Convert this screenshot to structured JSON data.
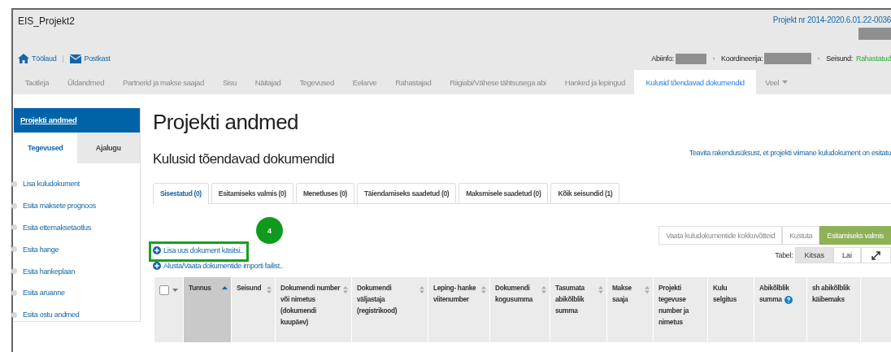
{
  "window": {
    "title": "EIS_Projekt2",
    "project_number": "Projekt nr 2014-2020.6.01.22-0036"
  },
  "quick_links": [
    {
      "kind": "home",
      "label": "Töölaud"
    },
    {
      "kind": "mail",
      "label": "Postkast"
    }
  ],
  "info": {
    "help_label": "Abiinfo:",
    "coordinator_label": "Koordineerija:",
    "status_label": "Seisund:",
    "status_value": "Rahastatud"
  },
  "tabs": [
    {
      "label": "Taotleja",
      "selected": false
    },
    {
      "label": "Üldandmed",
      "selected": false
    },
    {
      "label": "Partnerid ja makse saajad",
      "selected": false
    },
    {
      "label": "Sisu",
      "selected": false
    },
    {
      "label": "Näitajad",
      "selected": false
    },
    {
      "label": "Tegevused",
      "selected": false
    },
    {
      "label": "Eelarve",
      "selected": false
    },
    {
      "label": "Rahastajad",
      "selected": false
    },
    {
      "label": "Riigiabi/Vähese tähtsusega abi",
      "selected": false
    },
    {
      "label": "Hanked ja lepingud",
      "selected": false
    },
    {
      "label": "Kulusid tõendavad dokumendid",
      "selected": true
    },
    {
      "label": "Veel",
      "selected": false,
      "dropdown": true
    }
  ],
  "sidebar": {
    "header": "Projekti andmed",
    "tabs": [
      {
        "label": "Tegevused",
        "selected": true
      },
      {
        "label": "Ajalugu",
        "selected": false
      }
    ],
    "items": [
      "Lisa kuludokument",
      "Esita maksete prognoos",
      "Esita ettemaksetaotlus",
      "Esita hange",
      "Esita hankeplaan",
      "Esita aruanne",
      "Esita ostu andmed"
    ]
  },
  "page_title": "Projekti andmed",
  "section_title": "Kulusid tõendavad dokumendid",
  "notify_link": "Teavita rakendusüksust, et projekti viimane kuludokument on esitatu",
  "status_tabs": [
    {
      "label": "Sisestatud (0)",
      "selected": true
    },
    {
      "label": "Esitamiseks valmis (0)",
      "selected": false
    },
    {
      "label": "Menetluses (0)",
      "selected": false
    },
    {
      "label": "Täiendamiseks saadetud (0)",
      "selected": false
    },
    {
      "label": "Maksmisele saadetud (0)",
      "selected": false
    },
    {
      "label": "Kõik seisundid (1)",
      "selected": false
    }
  ],
  "step_badge": "4",
  "add_links": [
    {
      "label": "Lisa uus dokument käsitsi..",
      "highlighted": true
    },
    {
      "label": "Alusta/Vaata dokumentide importi failist..",
      "highlighted": false
    }
  ],
  "action_buttons": [
    {
      "label": "Vaata kuludokumentide kokkuvõtteid",
      "kind": "default"
    },
    {
      "label": "Kustuta",
      "kind": "default"
    },
    {
      "label": "Esitamiseks valmis",
      "kind": "primary"
    }
  ],
  "table_view": {
    "label": "Tabel:",
    "options": [
      {
        "label": "Kitsas",
        "selected": true
      },
      {
        "label": "Lai",
        "selected": false
      }
    ]
  },
  "table": {
    "select_all_checked": false,
    "columns": [
      {
        "label": "Tunnus",
        "sortable": true,
        "sorted": true,
        "help": false
      },
      {
        "label": "Seisund",
        "sortable": true,
        "sorted": false,
        "help": false
      },
      {
        "label": "Dokumendi number või nimetus (dokumendi kuupäev)",
        "sortable": true,
        "sorted": false,
        "help": false
      },
      {
        "label": "Dokumendi väljastaja (registrikood)",
        "sortable": true,
        "sorted": false,
        "help": false
      },
      {
        "label": "Leping- hanke viitenumber",
        "sortable": true,
        "sorted": false,
        "help": false
      },
      {
        "label": "Dokumendi kogusumma",
        "sortable": true,
        "sorted": false,
        "help": false
      },
      {
        "label": "Tasumata abikõlblik summa",
        "sortable": true,
        "sorted": false,
        "help": false
      },
      {
        "label": "Makse saaja",
        "sortable": true,
        "sorted": false,
        "help": false
      },
      {
        "label": "Projekti tegevuse number ja nimetus",
        "sortable": false,
        "sorted": false,
        "help": false
      },
      {
        "label": "Kulu selgitus",
        "sortable": false,
        "sorted": false,
        "help": false
      },
      {
        "label": "Abikõlblik summa",
        "sortable": false,
        "sorted": false,
        "help": true
      },
      {
        "label": "sh abikõlblik käibemaks",
        "sortable": false,
        "sorted": false,
        "help": false
      }
    ]
  }
}
